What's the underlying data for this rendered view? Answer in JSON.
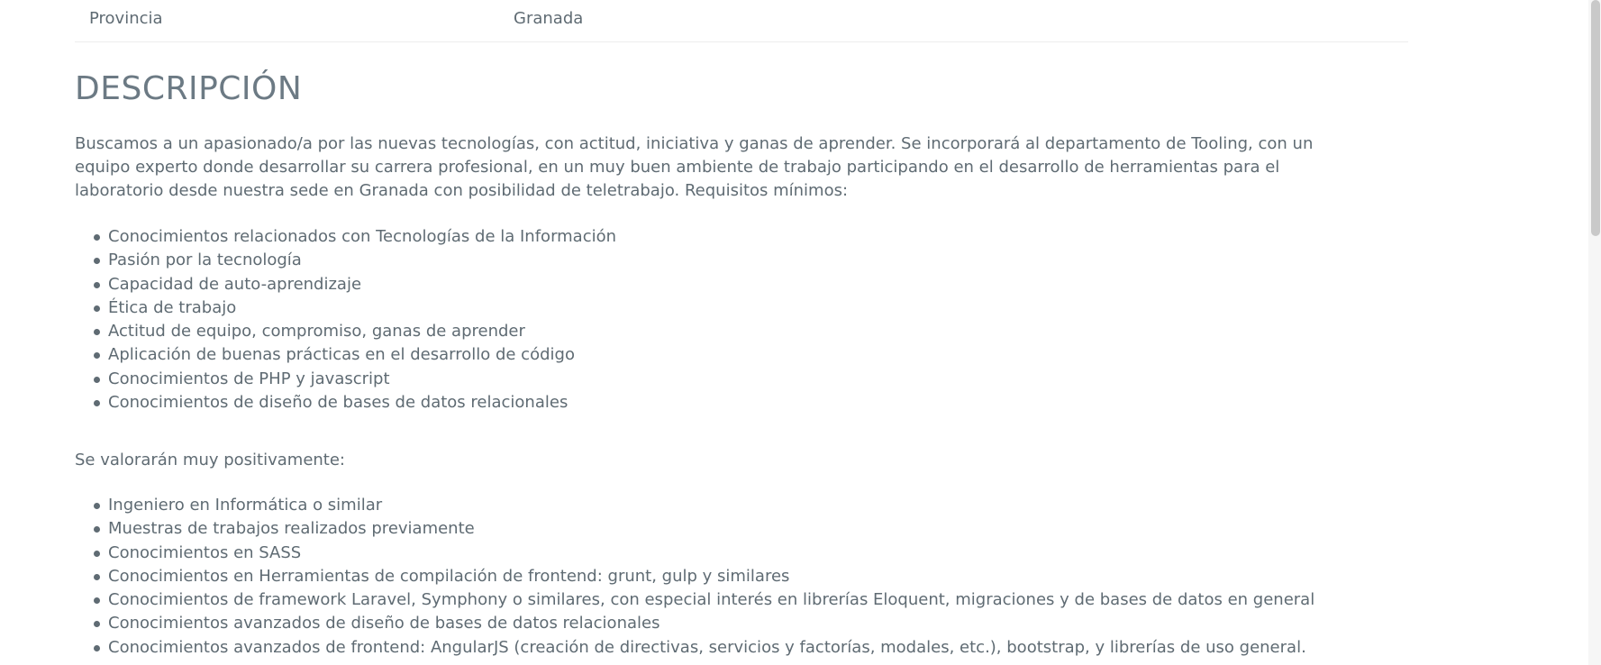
{
  "detail": {
    "key": "Provincia",
    "value": "Granada"
  },
  "description": {
    "title": "DESCRIPCIÓN",
    "paragraph": "Buscamos a un apasionado/a por las nuevas tecnologías, con actitud, iniciativa y ganas de aprender. Se incorporará al departamento de Tooling, con un equipo experto donde desarrollar su carrera profesional, en un muy buen ambiente de trabajo participando en el desarrollo de herramientas para el laboratorio desde nuestra sede en Granada con posibilidad de teletrabajo. Requisitos mínimos:",
    "requirements": [
      "Conocimientos relacionados con Tecnologías de la Información",
      "Pasión por la tecnología",
      "Capacidad de auto-aprendizaje",
      "Ética de trabajo",
      "Actitud de equipo, compromiso, ganas de aprender",
      "Aplicación de buenas prácticas en el desarrollo de código",
      "Conocimientos de PHP y javascript",
      "Conocimientos de diseño de bases de datos relacionales"
    ],
    "positive_heading": "Se valorarán muy positivamente:",
    "positives": [
      "Ingeniero en Informática o similar",
      "Muestras de trabajos realizados previamente",
      "Conocimientos en SASS",
      "Conocimientos en Herramientas de compilación de frontend: grunt, gulp y similares",
      "Conocimientos de framework Laravel, Symphony o similares, con especial interés en librerías Eloquent, migraciones y de bases de datos en general",
      "Conocimientos avanzados de diseño de bases de datos relacionales",
      "Conocimientos avanzados de frontend: AngularJS (creación de directivas, servicios y factorías, modales, etc.), bootstrap, y librerías de uso general."
    ]
  }
}
